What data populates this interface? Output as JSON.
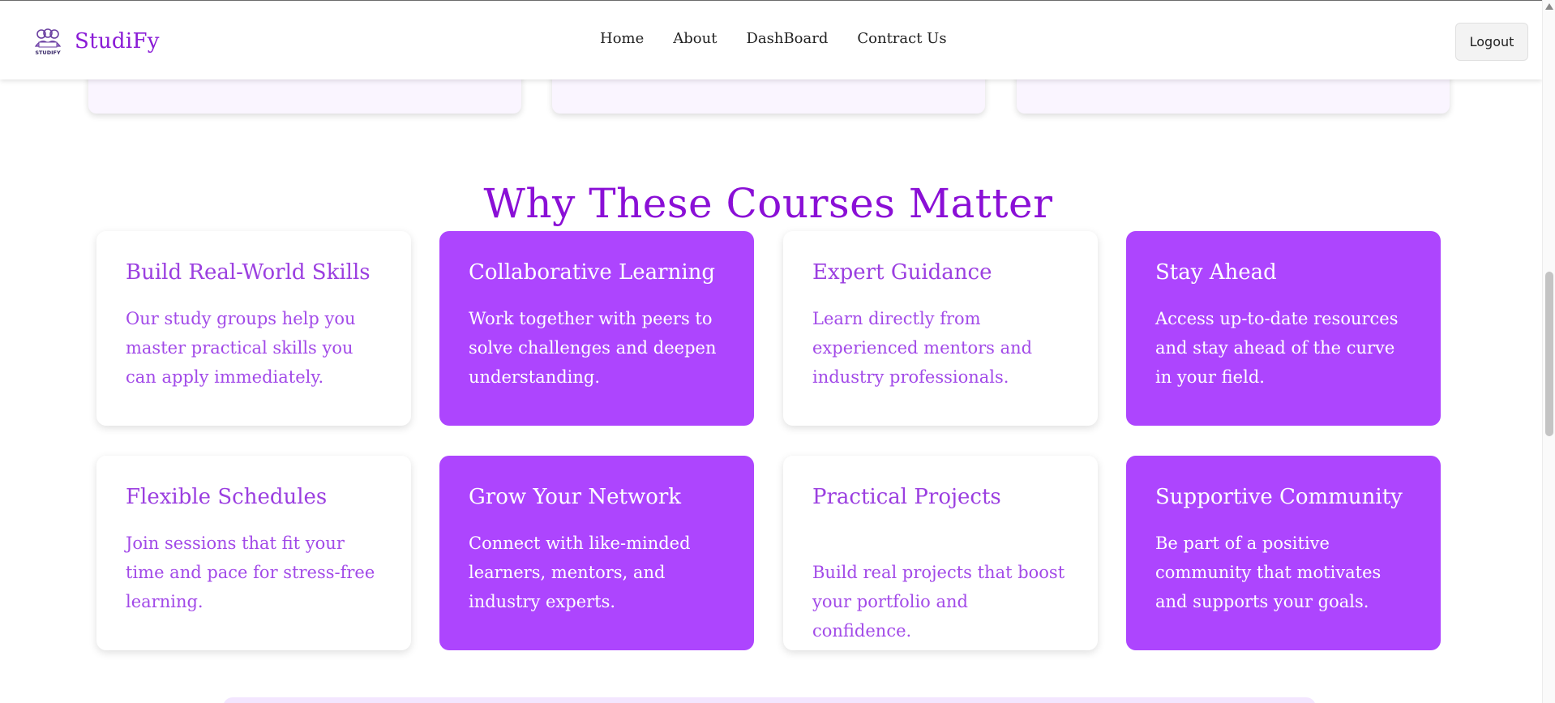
{
  "brand": {
    "name": "StudiFy",
    "logo_icon": "studify-logo-icon",
    "logo_text": "STUDIFY"
  },
  "nav": {
    "links": [
      "Home",
      "About",
      "DashBoard",
      "Contract Us"
    ]
  },
  "logout_label": "Logout",
  "section": {
    "title": "Why These Courses Matter",
    "cards": [
      {
        "title": "Build Real-World Skills",
        "text": "Our study groups help you master practical skills you can apply immediately.",
        "style": "light"
      },
      {
        "title": "Collaborative Learning",
        "text": "Work together with peers to solve challenges and deepen understanding.",
        "style": "dark"
      },
      {
        "title": "Expert Guidance",
        "text": "Learn directly from experienced mentors and industry professionals.",
        "style": "light"
      },
      {
        "title": "Stay Ahead",
        "text": "Access up-to-date resources and stay ahead of the curve in your field.",
        "style": "dark"
      },
      {
        "title": "Flexible Schedules",
        "text": "Join sessions that fit your time and pace for stress-free learning.",
        "style": "light"
      },
      {
        "title": "Grow Your Network",
        "text": "Connect with like-minded learners, mentors, and industry experts.",
        "style": "dark"
      },
      {
        "title": "Practical Projects",
        "text": "Build real projects that boost your portfolio and confidence.",
        "style": "light"
      },
      {
        "title": "Supportive Community",
        "text": "Be part of a positive community that motivates and supports your goals.",
        "style": "dark"
      }
    ]
  },
  "colors": {
    "brand_purple": "#8a1bd6",
    "card_purple": "#ad45fe",
    "light_card_text": "#a24ae8",
    "top_card_bg": "#faf5ff"
  }
}
